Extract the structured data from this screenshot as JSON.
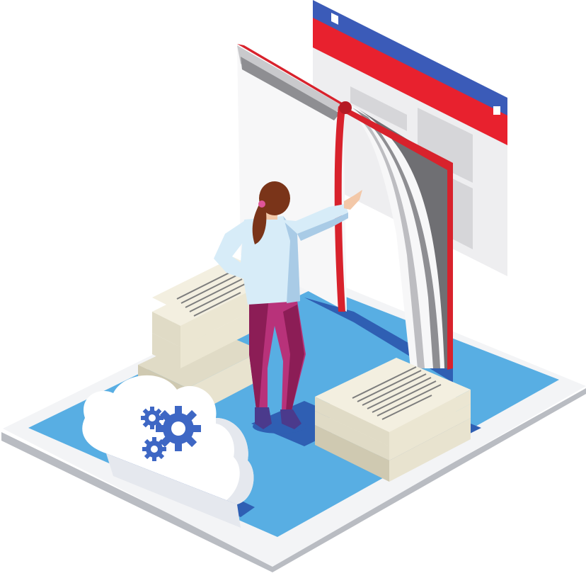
{
  "scene": {
    "type": "isometric-illustration",
    "subject": "woman-reading-giant-book-on-tablet",
    "text": []
  },
  "colors": {
    "background": "#ffffff",
    "tablet_frame": "#f3f4f6",
    "tablet_shadow": "#b9bcc2",
    "screen_light": "#58aee3",
    "screen_dark": "#2f5fb3",
    "browser_header_blue": "#3b5bb8",
    "browser_header_red": "#e8212e",
    "browser_body": "#eeeef0",
    "placeholder_gray": "#d6d6d9",
    "book_page": "#f7f7f8",
    "book_page_shade": "#c9c9cc",
    "book_cover_red": "#d8222c",
    "ribbon_red": "#d8222c",
    "paper": "#f3efe0",
    "paper_edge": "#e0dbc6",
    "paper_lines": "#7d7d7d",
    "cloud": "#ffffff",
    "cloud_shade": "#e5e8ee",
    "gear_blue": "#3e67c4",
    "shirt": "#d7ecf8",
    "shirt_shade": "#a9cbe6",
    "pants": "#b8327a",
    "pants_shade": "#8c1d56",
    "hair": "#7a3419",
    "skin": "#f3c8a8",
    "shoes": "#4b3a8c"
  },
  "icons": [
    "gear-icon",
    "cloud-icon",
    "document-icon",
    "browser-window-icon",
    "book-icon"
  ]
}
